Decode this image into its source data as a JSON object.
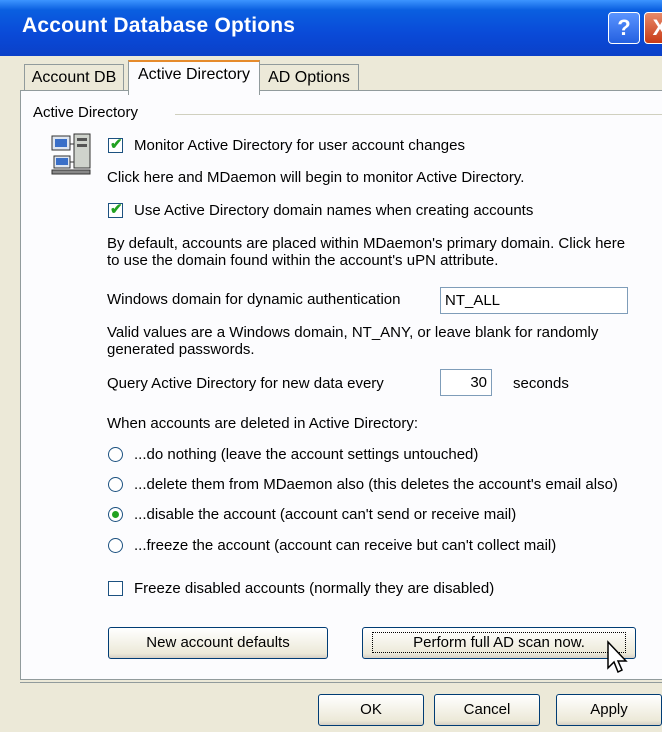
{
  "window": {
    "title": "Account Database Options"
  },
  "titlebar": {
    "help_glyph": "?",
    "close_glyph": "X"
  },
  "tabs": [
    {
      "label": "Account DB",
      "active": false
    },
    {
      "label": "Active Directory",
      "active": true
    },
    {
      "label": "AD Options",
      "active": false
    }
  ],
  "group": {
    "label": "Active Directory",
    "icon": "network-computer-icon"
  },
  "monitor": {
    "label": "Monitor Active Directory for user account changes",
    "checked": true,
    "help": "Click here and MDaemon will begin to monitor Active Directory."
  },
  "domain_names": {
    "label": "Use Active Directory domain names when creating accounts",
    "checked": true,
    "help_line1": "By default, accounts are placed within MDaemon's primary domain.  Click here",
    "help_line2": "to use the domain found within the account's uPN attribute."
  },
  "windows_domain": {
    "label": "Windows domain for dynamic authentication",
    "value": "NT_ALL",
    "help_line1": "Valid values are a Windows domain, NT_ANY, or leave blank for randomly",
    "help_line2": "generated passwords."
  },
  "query": {
    "label": "Query Active Directory for new data every",
    "value": "30",
    "unit": "seconds"
  },
  "deleted": {
    "label": "When accounts are deleted in Active Directory:",
    "options": [
      {
        "label": "...do nothing (leave the account settings untouched)",
        "selected": false
      },
      {
        "label": "...delete them from MDaemon also (this deletes the account's email also)",
        "selected": false
      },
      {
        "label": "...disable the account (account can't send or receive mail)",
        "selected": true
      },
      {
        "label": "...freeze the account (account can receive but can't collect mail)",
        "selected": false
      }
    ]
  },
  "freeze_disabled": {
    "label": "Freeze disabled accounts (normally they are disabled)",
    "checked": false
  },
  "buttons": {
    "new_defaults": "New account defaults",
    "full_scan": "Perform full AD scan now.",
    "ok": "OK",
    "cancel": "Cancel",
    "apply": "Apply"
  },
  "colors": {
    "titlebar": "#0a4ad8",
    "dialog_bg": "#ece9d8",
    "panel_bg": "#fcfcfe",
    "check": "#21a121",
    "tab_accent": "#e68b2c"
  }
}
